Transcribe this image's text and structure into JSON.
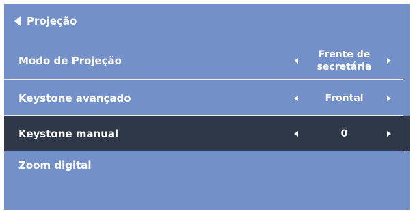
{
  "header": {
    "title": "Projeção",
    "back_icon": "back-arrow-icon"
  },
  "menu": {
    "items": [
      {
        "label": "Modo de Projeção",
        "value": "Frente de secretária",
        "selected": false
      },
      {
        "label": "Keystone avançado",
        "value": "Frontal",
        "selected": false
      },
      {
        "label": "Keystone manual",
        "value": "0",
        "selected": true
      },
      {
        "label": "Zoom digital",
        "value": "",
        "selected": false
      }
    ]
  },
  "colors": {
    "panel_bg": "#7490c8",
    "selected_bg": "#2f3848",
    "text": "#ffffff"
  }
}
